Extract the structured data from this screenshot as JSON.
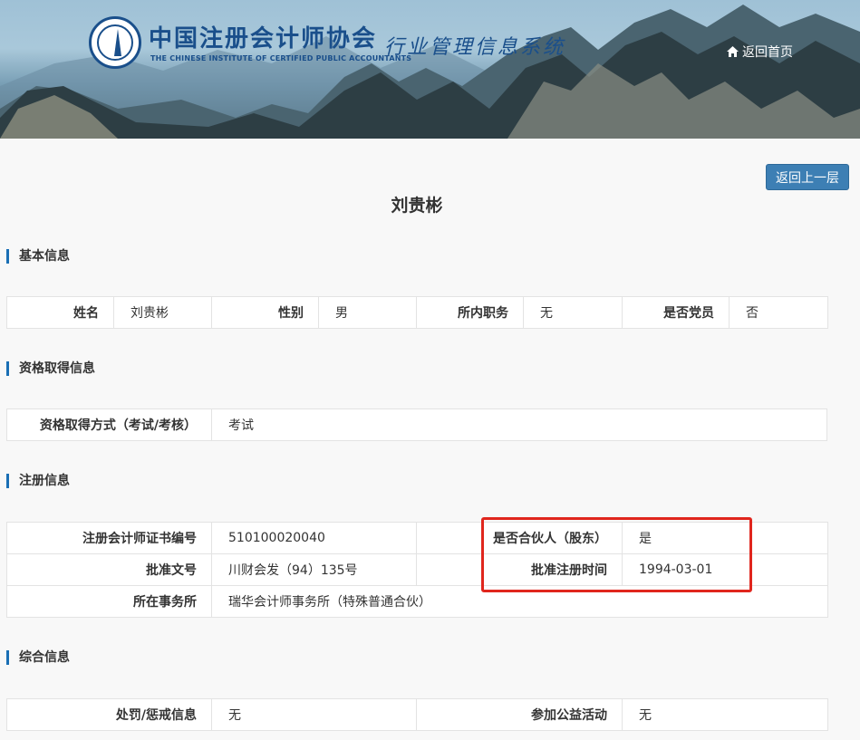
{
  "header": {
    "org_name_cn": "中国注册会计师协会",
    "org_name_en": "THE CHINESE INSTITUTE OF CERTIFIED PUBLIC ACCOUNTANTS",
    "system_title": "行业管理信息系统",
    "home_link": "返回首页",
    "home_icon": "home-icon"
  },
  "back_button": "返回上一层",
  "person_name": "刘贵彬",
  "sections": {
    "basic": {
      "title": "基本信息",
      "name_label": "姓名",
      "name_value": "刘贵彬",
      "gender_label": "性别",
      "gender_value": "男",
      "position_label": "所内职务",
      "position_value": "无",
      "party_label": "是否党员",
      "party_value": "否"
    },
    "qualification": {
      "title": "资格取得信息",
      "method_label": "资格取得方式（考试/考核）",
      "method_value": "考试"
    },
    "registration": {
      "title": "注册信息",
      "cert_label": "注册会计师证书编号",
      "cert_value": "510100020040",
      "partner_label": "是否合伙人（股东）",
      "partner_value": "是",
      "approval_doc_label": "批准文号",
      "approval_doc_value": "川财会发（94）135号",
      "approval_date_label": "批准注册时间",
      "approval_date_value": "1994-03-01",
      "firm_label": "所在事务所",
      "firm_value": "瑞华会计师事务所（特殊普通合伙）"
    },
    "comprehensive": {
      "title": "综合信息",
      "penalty_label": "处罚/惩戒信息",
      "penalty_value": "无",
      "charity_label": "参加公益活动",
      "charity_value": "无"
    }
  },
  "colors": {
    "accent": "#1a6fb5",
    "button": "#3d7fb4",
    "highlight": "#e0261d",
    "brand": "#1a4f8b"
  }
}
